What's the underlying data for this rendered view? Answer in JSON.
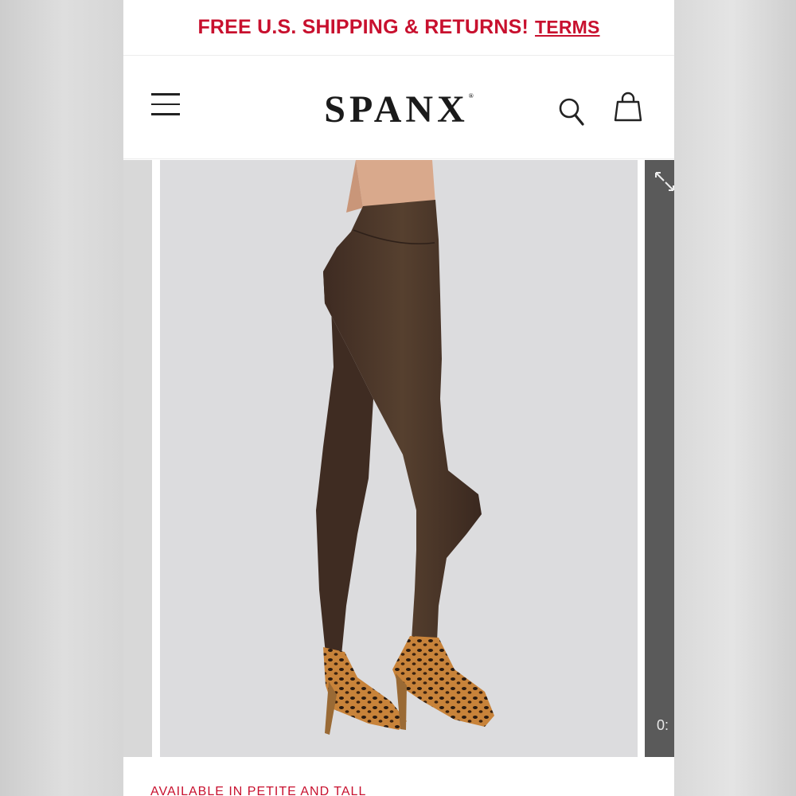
{
  "promo": {
    "text": "FREE U.S. SHIPPING & RETURNS!",
    "link": "TERMS"
  },
  "header": {
    "logo": "SPANX",
    "trademark": "®",
    "icons": [
      "menu-icon",
      "search-icon",
      "shopping-bag-icon"
    ]
  },
  "gallery": {
    "product_image": "brown faux suede leggings with leopard print heels",
    "next_slide_time": "0:"
  },
  "below_fold": {
    "partial_text": "AVAILABLE IN PETITE AND TALL"
  },
  "colors": {
    "promo_red": "#c8102e",
    "legging_brown": "#4a3429",
    "gallery_bg": "#dcdcde"
  }
}
